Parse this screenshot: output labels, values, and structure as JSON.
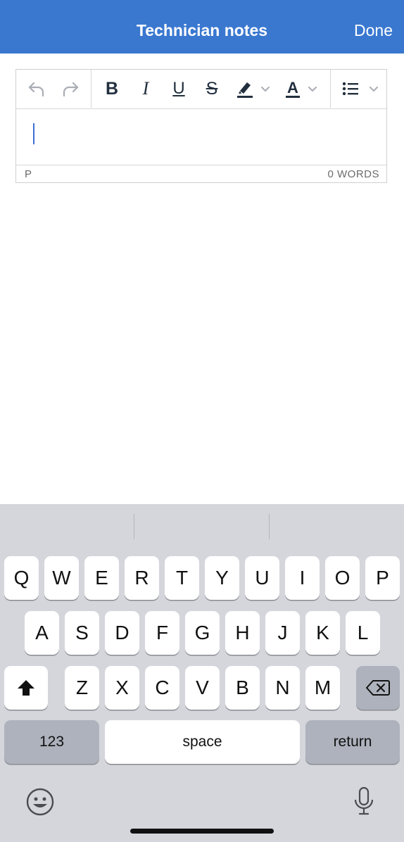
{
  "header": {
    "title": "Technician notes",
    "done_label": "Done"
  },
  "editor": {
    "toolbar": {
      "buttons": [
        "undo",
        "redo",
        "bold",
        "italic",
        "underline",
        "strikethrough",
        "highlight-color",
        "text-color",
        "bullet-list"
      ],
      "bold_glyph": "B",
      "italic_glyph": "I",
      "underline_glyph": "U",
      "strike_glyph": "S",
      "textcolor_glyph": "A"
    },
    "body_text": "",
    "status_path": "P",
    "word_count": "0 WORDS"
  },
  "keyboard": {
    "row1": [
      "Q",
      "W",
      "E",
      "R",
      "T",
      "Y",
      "U",
      "I",
      "O",
      "P"
    ],
    "row2": [
      "A",
      "S",
      "D",
      "F",
      "G",
      "H",
      "J",
      "K",
      "L"
    ],
    "row3": [
      "Z",
      "X",
      "C",
      "V",
      "B",
      "N",
      "M"
    ],
    "numbers_label": "123",
    "space_label": "space",
    "return_label": "return"
  },
  "colors": {
    "header_bg": "#3a78d0",
    "caret": "#3f6fd5",
    "keyboard_bg": "#d4d6dc"
  }
}
